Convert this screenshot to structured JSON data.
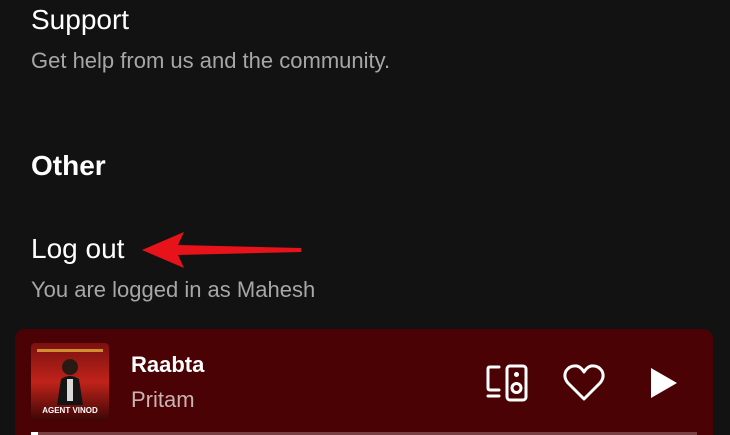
{
  "settings": {
    "support": {
      "title": "Support",
      "subtitle": "Get help from us and the community."
    },
    "other": {
      "heading": "Other"
    },
    "logout": {
      "title": "Log out",
      "subtitle": "You are logged in as Mahesh"
    }
  },
  "annotation": {
    "arrow_color": "#e8121a"
  },
  "now_playing": {
    "title": "Raabta",
    "artist": "Pritam",
    "album_art_text": "AGENT VINOD",
    "background_color": "#4a0205",
    "progress_fraction": 0.01,
    "icons": [
      "devices-icon",
      "heart-icon",
      "play-icon"
    ]
  }
}
